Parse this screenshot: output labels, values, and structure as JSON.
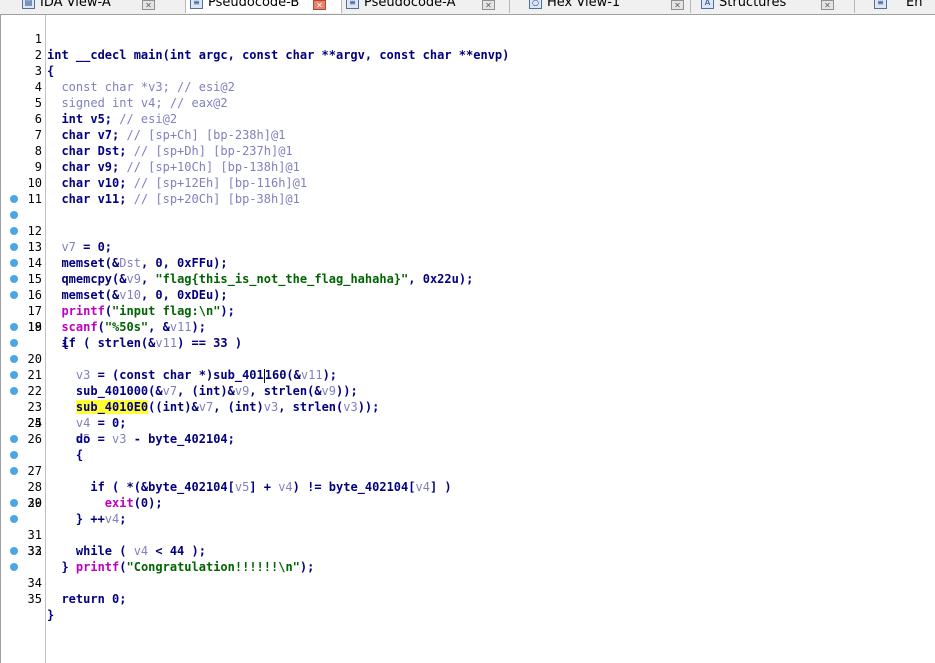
{
  "tabs": [
    {
      "label": "IDA View-A",
      "icon": "ida-view-icon",
      "active": false
    },
    {
      "label": "Pseudocode-B",
      "icon": "pseudocode-icon",
      "active": true
    },
    {
      "label": "Pseudocode-A",
      "icon": "pseudocode-icon",
      "active": false
    },
    {
      "label": "Hex View-1",
      "icon": "hex-view-icon",
      "active": false
    },
    {
      "label": "Structures",
      "icon": "structures-icon",
      "active": false
    },
    {
      "label": "En",
      "icon": "enums-icon",
      "active": false
    }
  ],
  "colors": {
    "keyword": "#000080",
    "comment": "#8080c0",
    "string": "#006400",
    "library_function": "#c000c0",
    "highlight": "#ffff33",
    "breakpoint": "#4aa8e0"
  },
  "code": {
    "line_numbers": [
      "1",
      "2",
      "3",
      "4",
      "5",
      "6",
      "7",
      "8",
      "9",
      "10",
      "11",
      "12",
      "13",
      "14",
      "15",
      "16",
      "17",
      "18",
      "19",
      "20",
      "21",
      "22",
      "23",
      "24",
      "25",
      "26",
      "27",
      "28",
      "29",
      "30",
      "31",
      "32",
      "33",
      "34",
      "35"
    ],
    "l1": "int __cdecl main(int argc, const char **argv, const char **envp)",
    "l2": "{",
    "l3a": "  const char *v3; ",
    "l3b": "// esi@2",
    "l4a": "  signed int v4; ",
    "l4b": "// eax@2",
    "l5a": "  int v5; ",
    "l5b": "// esi@2",
    "l6a": "  char v7; ",
    "l6b": "// [sp+Ch] [bp-238h]@1",
    "l7a": "  char Dst; ",
    "l7b": "// [sp+Dh] [bp-237h]@1",
    "l8a": "  char v9; ",
    "l8b": "// [sp+10Ch] [bp-138h]@1",
    "l9a": "  char v10; ",
    "l9b": "// [sp+12Eh] [bp-116h]@1",
    "l10a": "  char v11; ",
    "l10b": "// [sp+20Ch] [bp-38h]@1",
    "l12a": "  ",
    "l12b": "v7",
    "l12c": " = 0;",
    "l13a": "  memset(&",
    "l13b": "Dst",
    "l13c": ", 0, 0xFFu);",
    "l14a": "  qmemcpy(&",
    "l14b": "v9",
    "l14c": ", ",
    "l14d": "\"flag{this_is_not_the_flag_hahaha}\"",
    "l14e": ", 0x22u);",
    "l15a": "  memset(&",
    "l15b": "v10",
    "l15c": ", 0, 0xDEu);",
    "l16a": "  ",
    "l16b": "printf",
    "l16c": "(",
    "l16d": "\"input flag:\\n\"",
    "l16e": ");",
    "l17a": "  ",
    "l17b": "scanf",
    "l17c": "(",
    "l17d": "\"%50s\"",
    "l17e": ", &",
    "l17f": "v11",
    "l17g": ");",
    "l18a": "  if ( strlen(&",
    "l18b": "v11",
    "l18c": ") == 33 )",
    "l19": "  {",
    "l20a": "    ",
    "l20b": "v3",
    "l20c": " = (const char *)sub_401",
    "l20d": "160(&",
    "l20e": "v11",
    "l20f": ");",
    "l21a": "    sub_401000(&",
    "l21b": "v7",
    "l21c": ", (int)&",
    "l21d": "v9",
    "l21e": ", strlen(&",
    "l21f": "v9",
    "l21g": "));",
    "l22a": "    ",
    "l22b": "sub_4010E0",
    "l22c": "((int)&",
    "l22d": "v7",
    "l22e": ", (int)",
    "l22f": "v3",
    "l22g": ", strlen(",
    "l22h": "v3",
    "l22i": "));",
    "l23a": "    ",
    "l23b": "v4",
    "l23c": " = 0;",
    "l24a": "    ",
    "l24b": "v5",
    "l24c": " = ",
    "l24d": "v3",
    "l24e": " - byte_402104;",
    "l25": "    do",
    "l26": "    {",
    "l27a": "      if ( *(&byte_402104[",
    "l27b": "v5",
    "l27c": "] + ",
    "l27d": "v4",
    "l27e": ") != byte_402104[",
    "l27f": "v4",
    "l27g": "] )",
    "l28a": "        ",
    "l28b": "exit",
    "l28c": "(0);",
    "l29a": "      ++",
    "l29b": "v4",
    "l29c": ";",
    "l30": "    }",
    "l31a": "    while ( ",
    "l31b": "v4",
    "l31c": " < 44 );",
    "l32a": "    ",
    "l32b": "printf",
    "l32c": "(",
    "l32d": "\"Congratulation!!!!!!\\n\"",
    "l32e": ");",
    "l33": "  }",
    "l34": "  return 0;",
    "l35": "}"
  }
}
